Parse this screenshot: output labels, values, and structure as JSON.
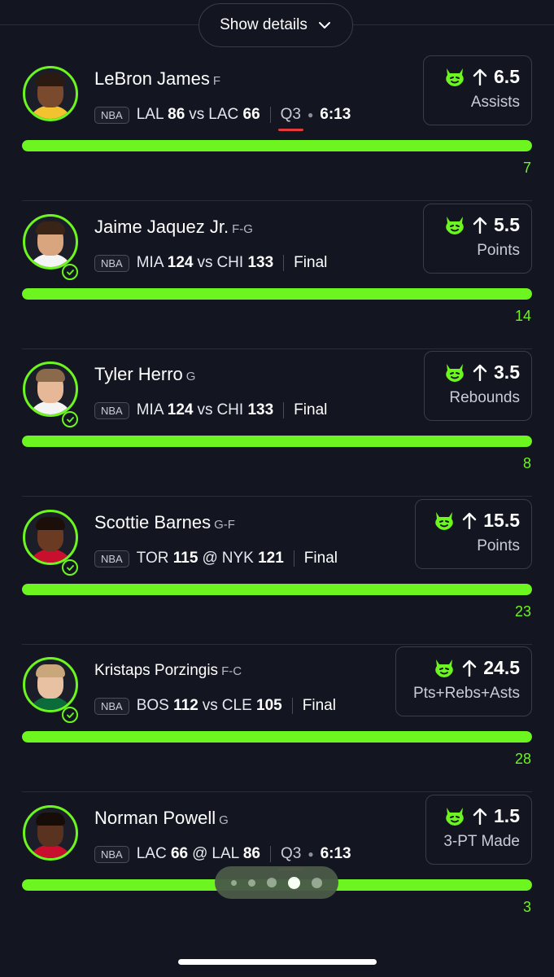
{
  "header": {
    "show_details_label": "Show details"
  },
  "picks": [
    {
      "player": "LeBron James",
      "position": "F",
      "league": "NBA",
      "team1": "LAL",
      "score1": "86",
      "connector": "vs",
      "team2": "LAC",
      "score2": "66",
      "status": "Q3",
      "clock": "6:13",
      "live": true,
      "line": "6.5",
      "stat": "Assists",
      "actual": "7",
      "progress": 1.0,
      "settled": false
    },
    {
      "player": "Jaime Jaquez Jr.",
      "position": "F-G",
      "league": "NBA",
      "team1": "MIA",
      "score1": "124",
      "connector": "vs",
      "team2": "CHI",
      "score2": "133",
      "status": "Final",
      "clock": "",
      "live": false,
      "line": "5.5",
      "stat": "Points",
      "actual": "14",
      "progress": 1.0,
      "settled": true
    },
    {
      "player": "Tyler Herro",
      "position": "G",
      "league": "NBA",
      "team1": "MIA",
      "score1": "124",
      "connector": "vs",
      "team2": "CHI",
      "score2": "133",
      "status": "Final",
      "clock": "",
      "live": false,
      "line": "3.5",
      "stat": "Rebounds",
      "actual": "8",
      "progress": 1.0,
      "settled": true
    },
    {
      "player": "Scottie Barnes",
      "position": "G-F",
      "league": "NBA",
      "team1": "TOR",
      "score1": "115",
      "connector": "@",
      "team2": "NYK",
      "score2": "121",
      "status": "Final",
      "clock": "",
      "live": false,
      "line": "15.5",
      "stat": "Points",
      "actual": "23",
      "progress": 1.0,
      "settled": true
    },
    {
      "player": "Kristaps Porzingis",
      "position": "F-C",
      "league": "NBA",
      "team1": "BOS",
      "score1": "112",
      "connector": "vs",
      "team2": "CLE",
      "score2": "105",
      "status": "Final",
      "clock": "",
      "live": false,
      "line": "24.5",
      "stat": "Pts+Rebs+Asts",
      "actual": "28",
      "progress": 1.0,
      "settled": true
    },
    {
      "player": "Norman Powell",
      "position": "G",
      "league": "NBA",
      "team1": "LAC",
      "score1": "66",
      "connector": "@",
      "team2": "LAL",
      "score2": "86",
      "status": "Q3",
      "clock": "6:13",
      "live": true,
      "line": "1.5",
      "stat": "3-PT Made",
      "actual": "3",
      "progress": 1.0,
      "settled": false
    }
  ],
  "pager": {
    "count": 5,
    "active_index": 3
  },
  "colors": {
    "accent": "#6cf51e",
    "background": "#131520",
    "live_underline": "#e33b3b"
  }
}
